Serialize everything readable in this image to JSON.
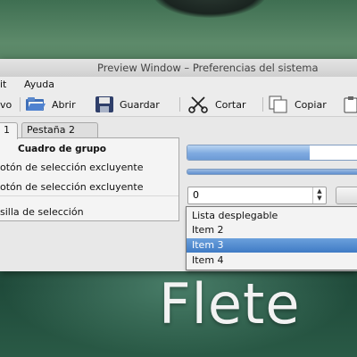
{
  "window": {
    "title": "Preview Window – Preferencias del sistema"
  },
  "menu": {
    "items": [
      {
        "label": "it"
      },
      {
        "label": "Ayuda"
      }
    ]
  },
  "toolbar": {
    "items": [
      {
        "label": "vo",
        "icon": "new-icon"
      },
      {
        "label": "Abrir",
        "icon": "folder-open-icon"
      },
      {
        "label": "Guardar",
        "icon": "floppy-disk-icon"
      },
      {
        "label": "Cortar",
        "icon": "scissors-icon"
      },
      {
        "label": "Copiar",
        "icon": "copy-icon"
      },
      {
        "label": "",
        "icon": "paste-icon"
      }
    ]
  },
  "tabs": [
    {
      "label": "1"
    },
    {
      "label": "Pestaña 2"
    }
  ],
  "group": {
    "title": "Cuadro de grupo",
    "radio1": "otón de selección excluyente",
    "radio2": "otón de selección excluyente",
    "checkbox": "silla de selección"
  },
  "progress": {
    "value": 0.7,
    "text": "70%"
  },
  "spin": {
    "value": "0"
  },
  "dropdown": {
    "items": [
      "Lista desplegable",
      "Item 2",
      "Item 3",
      "Item 4"
    ],
    "selected": "Item 3"
  },
  "brand": {
    "text": "Flete"
  },
  "colors": {
    "accent": "#3f7bc5",
    "window_bg": "#e8e8e8",
    "brand_text": "#f2f2f2"
  }
}
